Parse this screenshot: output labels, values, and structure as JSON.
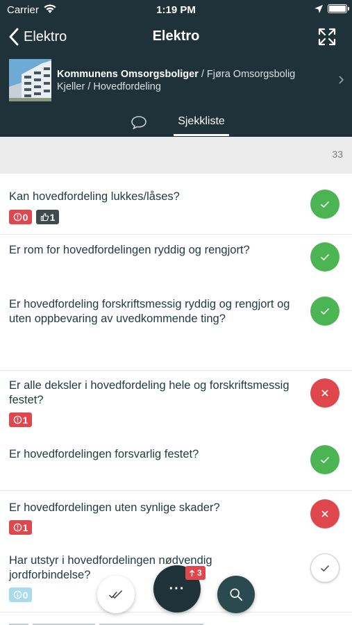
{
  "status_bar": {
    "carrier": "Carrier",
    "time": "1:19 PM"
  },
  "nav": {
    "back_label": "Elektro",
    "title": "Elektro"
  },
  "project": {
    "name": "Kommunens Omsorgsboliger",
    "path_1": " / Fjøra Omsorgsbolig",
    "path_2": "Kjeller / Hovedfordeling"
  },
  "tabs": {
    "checklist_label": "Sjekkliste"
  },
  "summary": {
    "count": "33"
  },
  "items": [
    {
      "question": "Kan hovedfordeling lukkes/låses?",
      "status": "ok",
      "issues": "0",
      "likes": "1"
    },
    {
      "question": "Er rom for hovedfordelingen ryddig og rengjort?",
      "status": "ok"
    },
    {
      "question": "Er hovedfordeling forskriftsmessig ryddig og rengjort og uten oppbevaring av uvedkommende ting?",
      "status": "ok"
    },
    {
      "question": "Er alle deksler i hovedfordeling hele og forskriftsmessig festet?",
      "status": "bad",
      "issues": "1"
    },
    {
      "question": "Er hovedfordelingen forsvarlig festet?",
      "status": "ok"
    },
    {
      "question": "Er hovedfordelingen uten synlige skader?",
      "status": "bad",
      "issues": "1"
    },
    {
      "question": "Har utstyr i hovedfordelingen nødvendig jordforbindelse?",
      "status": "pending",
      "info": "0"
    }
  ],
  "fab": {
    "more_label": "···",
    "upload_count": "3"
  },
  "colors": {
    "header_bg": "#1f3139",
    "ok": "#4cb553",
    "bad": "#e0474c"
  }
}
